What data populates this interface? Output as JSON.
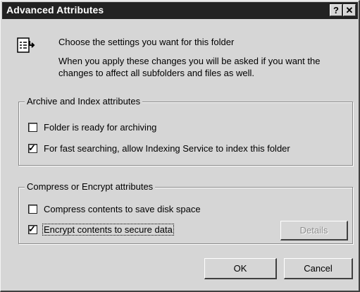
{
  "window": {
    "title": "Advanced Attributes",
    "help_button": "?",
    "close_button": "✕"
  },
  "intro": {
    "icon": "folder-attributes-icon",
    "line1": "Choose the settings you want for this folder",
    "line2": "When you apply these changes you will be asked if you want the changes to affect all subfolders and files as well."
  },
  "archive_group": {
    "label": "Archive and Index attributes",
    "items": [
      {
        "label": "Folder is ready for archiving",
        "checked": false
      },
      {
        "label": "For fast searching, allow Indexing Service to index this folder",
        "checked": true
      }
    ]
  },
  "compress_group": {
    "label": "Compress or Encrypt attributes",
    "items": [
      {
        "label": "Compress contents to save disk space",
        "checked": false
      },
      {
        "label": "Encrypt contents to secure data",
        "checked": true
      }
    ],
    "details_label": "Details"
  },
  "buttons": {
    "ok": "OK",
    "cancel": "Cancel"
  },
  "colors": {
    "titlebar": "#222222",
    "face": "#d6d6d6"
  }
}
